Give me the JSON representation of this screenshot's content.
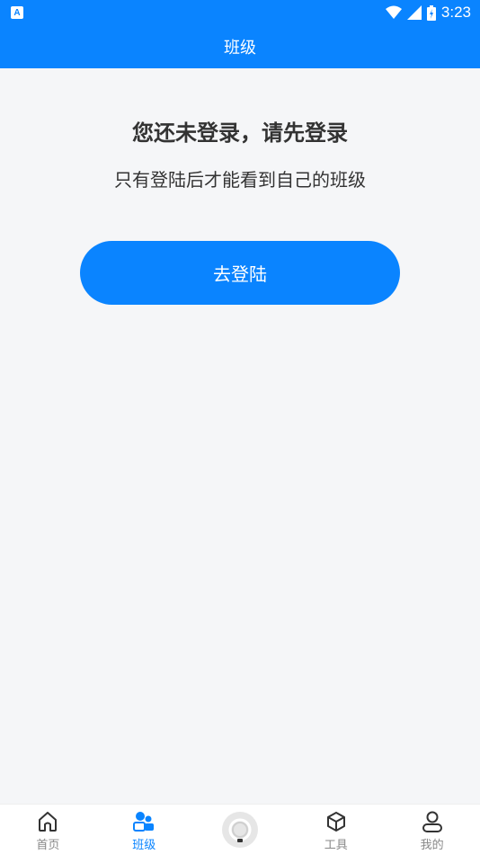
{
  "status_bar": {
    "app_icon_letter": "A",
    "time": "3:23"
  },
  "app_bar": {
    "title": "班级"
  },
  "main": {
    "headline": "您还未登录，请先登录",
    "subline": "只有登陆后才能看到自己的班级",
    "login_button": "去登陆"
  },
  "tab_bar": {
    "tabs": [
      {
        "label": "首页",
        "icon": "home-icon",
        "active": false
      },
      {
        "label": "班级",
        "icon": "class-icon",
        "active": true
      },
      {
        "label": "",
        "icon": "center-circle-icon",
        "active": false
      },
      {
        "label": "工具",
        "icon": "cube-icon",
        "active": false
      },
      {
        "label": "我的",
        "icon": "user-icon",
        "active": false
      }
    ]
  },
  "colors": {
    "primary": "#0a84ff",
    "background": "#f5f6f8",
    "text": "#333333",
    "tab_inactive": "#888888"
  }
}
